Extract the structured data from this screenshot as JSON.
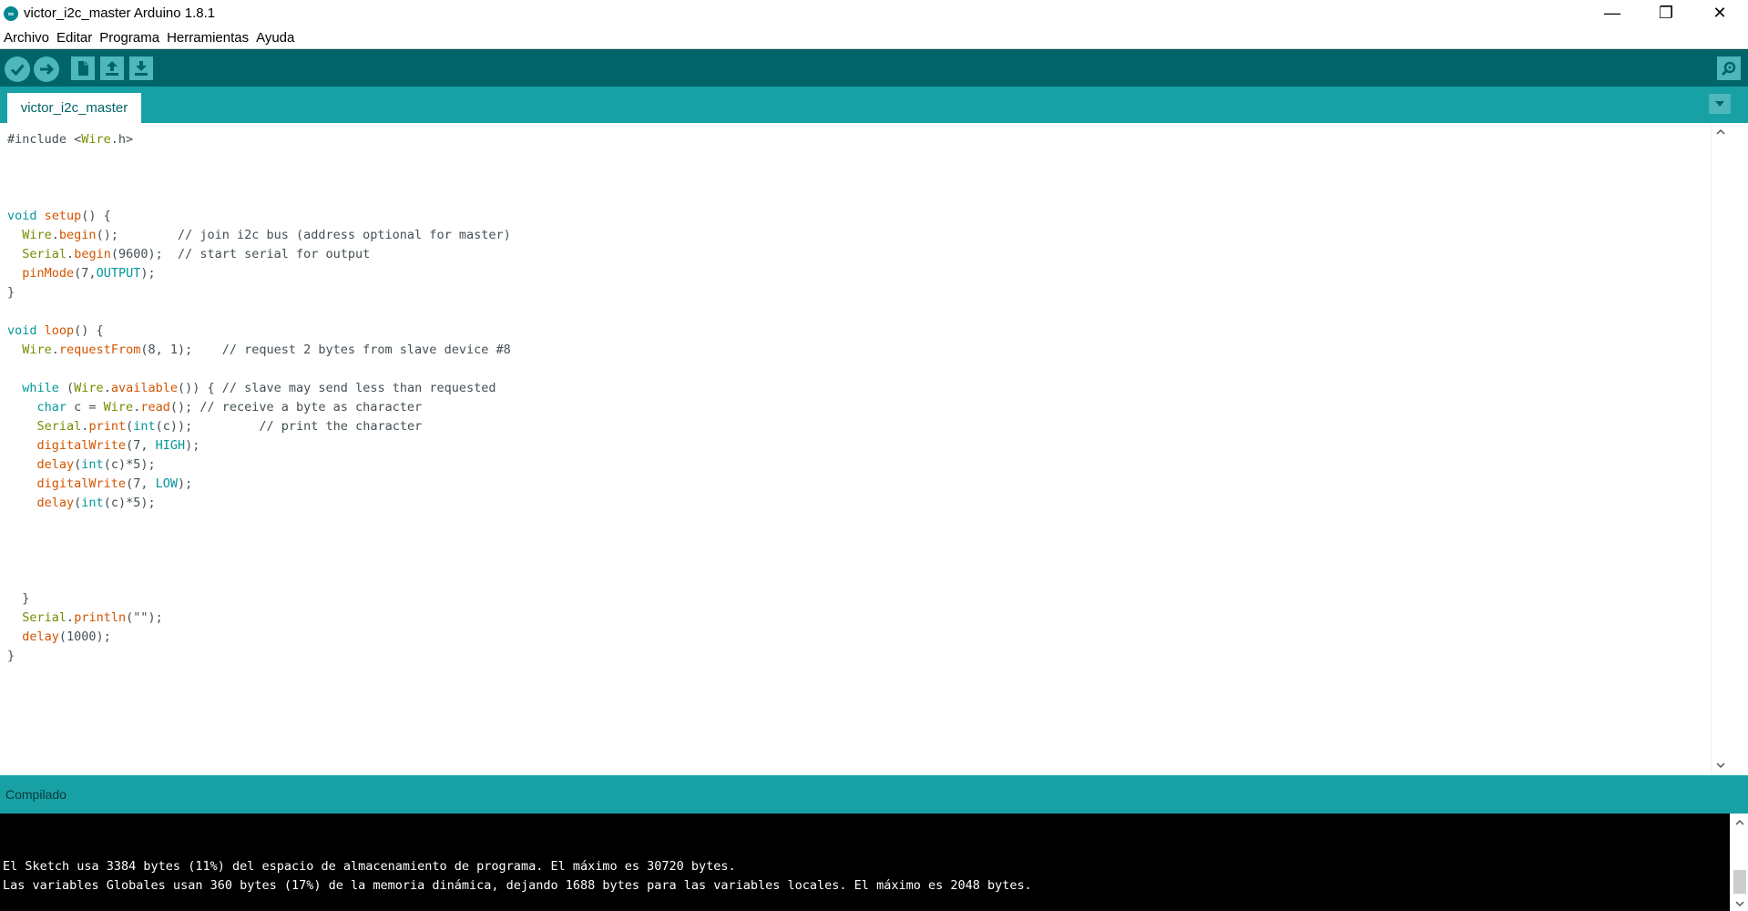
{
  "window": {
    "title": "victor_i2c_master Arduino 1.8.1",
    "logo_text": "∞",
    "minimize": "—",
    "maximize": "❐",
    "close": "✕"
  },
  "menu": [
    "Archivo",
    "Editar",
    "Programa",
    "Herramientas",
    "Ayuda"
  ],
  "toolbar": {
    "icons": [
      "verify-icon",
      "upload-icon",
      "new-icon",
      "open-icon",
      "save-icon",
      "serial-monitor-icon"
    ],
    "accent": "#4db7bb",
    "background": "#006468"
  },
  "tabs": [
    {
      "label": "victor_i2c_master"
    }
  ],
  "editor": {
    "lines": [
      "#include <Wire.h>",
      "",
      "",
      "",
      "void setup() {",
      "  Wire.begin();        // join i2c bus (address optional for master)",
      "  Serial.begin(9600);  // start serial for output",
      "  pinMode(7,OUTPUT);",
      "}",
      "",
      "void loop() {",
      "  Wire.requestFrom(8, 1);    // request 2 bytes from slave device #8",
      "",
      "  while (Wire.available()) { // slave may send less than requested",
      "    char c = Wire.read(); // receive a byte as character",
      "    Serial.print(int(c));         // print the character",
      "    digitalWrite(7, HIGH);",
      "    delay(int(c)*5);",
      "    digitalWrite(7, LOW);",
      "    delay(int(c)*5);",
      "",
      "",
      "",
      "",
      "  }",
      "  Serial.println(\"\");",
      "  delay(1000);",
      "}"
    ]
  },
  "status": {
    "text": "Compilado",
    "background": "#17a1a5"
  },
  "console": {
    "lines": [
      "El Sketch usa 3384 bytes (11%) del espacio de almacenamiento de programa. El máximo es 30720 bytes.",
      "Las variables Globales usan 360 bytes (17%) de la memoria dinámica, dejando 1688 bytes para las variables locales. El máximo es 2048 bytes."
    ]
  }
}
